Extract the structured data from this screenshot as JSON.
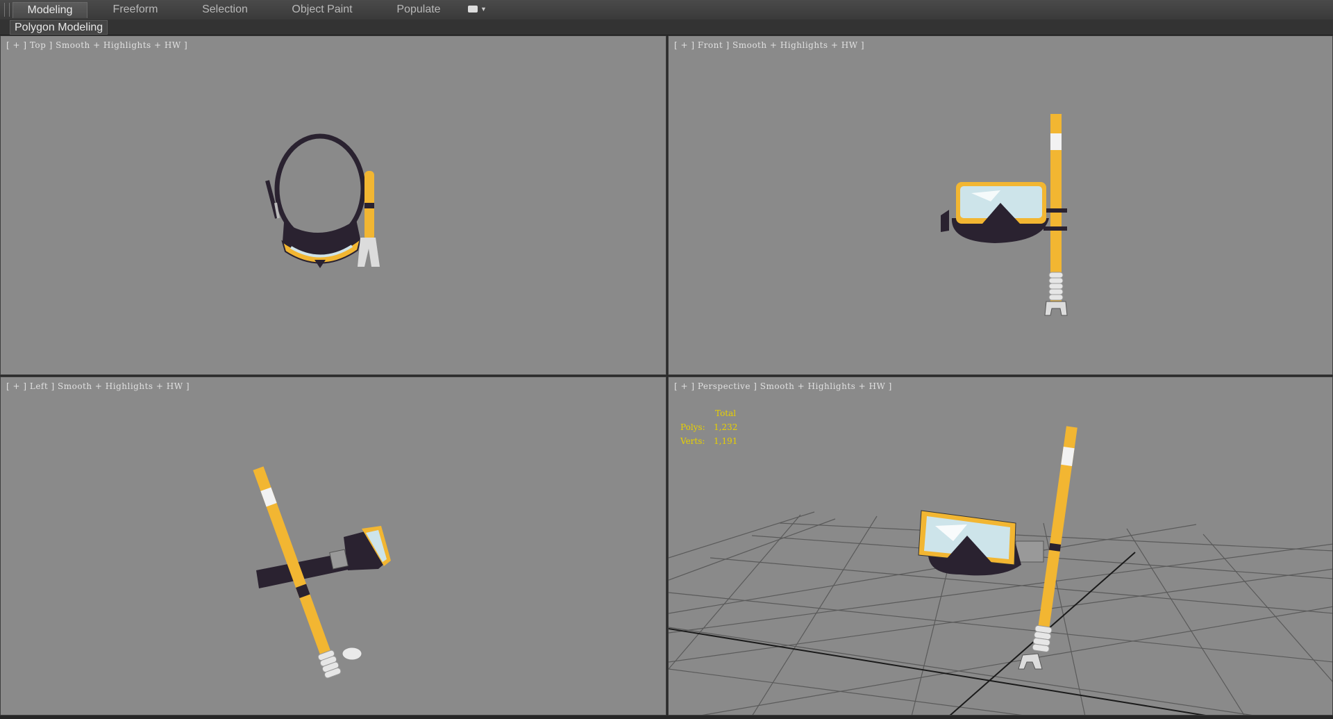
{
  "ribbon": {
    "tabs": [
      {
        "label": "Modeling",
        "active": true
      },
      {
        "label": "Freeform",
        "active": false
      },
      {
        "label": "Selection",
        "active": false
      },
      {
        "label": "Object Paint",
        "active": false
      },
      {
        "label": "Populate",
        "active": false
      }
    ],
    "panel_label": "Polygon Modeling",
    "more_icon": "display-options-icon"
  },
  "viewports": {
    "top": {
      "label": "[ + ] Top ] Smooth + Highlights + HW ]"
    },
    "front": {
      "label": "[ + ] Front ] Smooth + Highlights + HW ]"
    },
    "left": {
      "label": "[ + ] Left ] Smooth + Highlights + HW ]"
    },
    "perspective": {
      "label": "[ + ] Perspective ] Smooth + Highlights + HW ]"
    }
  },
  "stats": {
    "header": "Total",
    "polys_label": "Polys:",
    "polys_value": "1,232",
    "verts_label": "Verts:",
    "verts_value": "1,191"
  },
  "colors": {
    "viewport_bg": "#8a8a8a",
    "snorkel_yellow": "#f2b632",
    "mask_dark": "#2a2230",
    "stats_yellow": "#e8d000"
  }
}
